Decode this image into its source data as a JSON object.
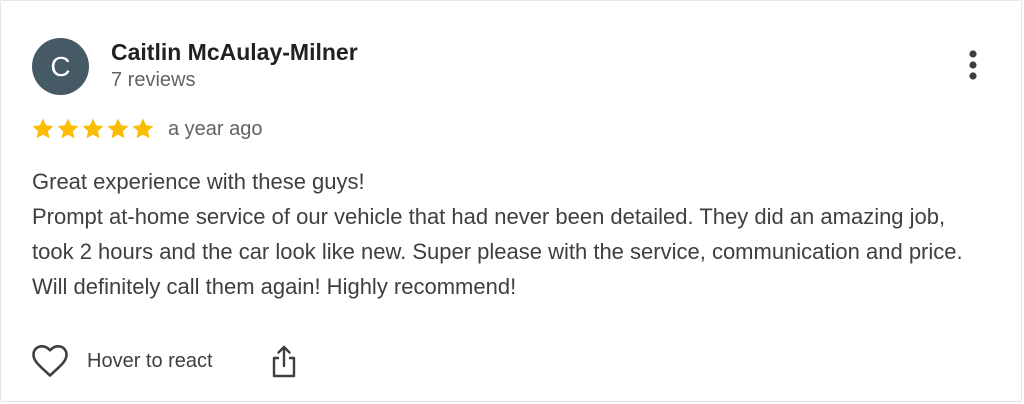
{
  "review": {
    "author": {
      "initial": "C",
      "name": "Caitlin McAulay-Milner",
      "reviews_count": "7 reviews",
      "avatar_color": "#455a64"
    },
    "rating": 5,
    "max_rating": 5,
    "star_color": "#fbbc04",
    "time_ago": "a year ago",
    "text_lines": [
      "Great experience with these guys!",
      "Prompt at-home service of our vehicle that had never been detailed. They did an amazing job, took 2 hours and the car look like new. Super please with the service, communication and price. Will definitely call them again! Highly recommend!"
    ],
    "actions": {
      "react_label": "Hover to react",
      "react_icon": "heart-outline-icon",
      "share_icon": "share-icon",
      "more_icon": "more-vert-icon"
    }
  }
}
